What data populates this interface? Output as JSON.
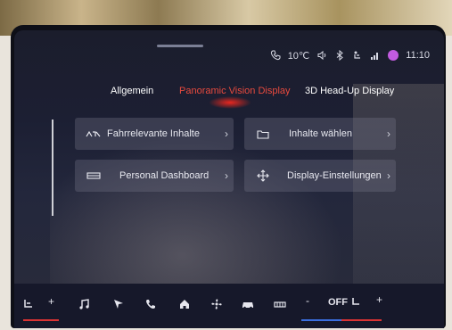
{
  "status_bar": {
    "temperature": "10℃",
    "time": "11:10",
    "icons": [
      "phone-icon",
      "volume-icon",
      "bluetooth-icon",
      "passenger-airbag-icon",
      "signal-icon",
      "profile-avatar"
    ]
  },
  "tabs": [
    {
      "label": "Allgemein",
      "active": false
    },
    {
      "label": "Panoramic Vision Display",
      "active": true
    },
    {
      "label": "3D Head-Up Display",
      "active": false
    }
  ],
  "cards": [
    {
      "label": "Fahrrelevante Inhalte",
      "icon": "gauge-icon"
    },
    {
      "label": "Inhalte wählen",
      "icon": "folder-icon"
    },
    {
      "label": "Personal Dashboard",
      "icon": "dashboard-icon"
    },
    {
      "label": "Display-Einstellungen",
      "icon": "move-icon"
    }
  ],
  "bottom_bar": {
    "plus_left": "+",
    "minus": "-",
    "climate": "OFF",
    "plus_right": "+",
    "icons": [
      "seat-heat-icon",
      "music-icon",
      "navigation-icon",
      "phone-icon",
      "home-icon",
      "fan-icon",
      "car-icon",
      "rear-defrost-icon"
    ]
  },
  "colors": {
    "accent": "#e84a3e",
    "card": "#5a5c70",
    "background": "#1c1f33"
  }
}
